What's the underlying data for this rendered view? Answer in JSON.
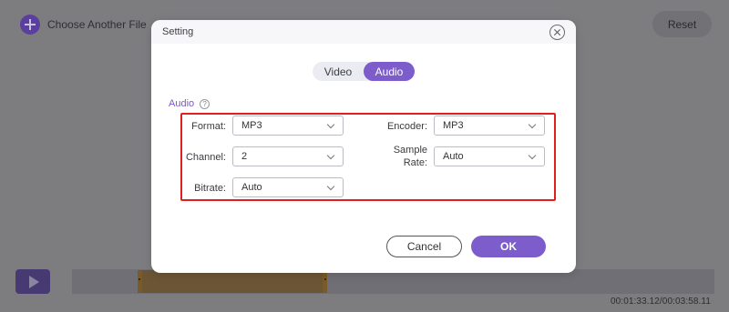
{
  "app": {
    "choose_file_label": "Choose Another File",
    "reset_label": "Reset",
    "time_readout": "00:01:33.12/00:03:58.11"
  },
  "dialog": {
    "title": "Setting",
    "tabs": [
      {
        "label": "Video",
        "selected": false
      },
      {
        "label": "Audio",
        "selected": true
      }
    ],
    "section_label": "Audio",
    "help_icon": "?",
    "fields": {
      "format": {
        "label": "Format:",
        "value": "MP3"
      },
      "channel": {
        "label": "Channel:",
        "value": "2"
      },
      "bitrate": {
        "label": "Bitrate:",
        "value": "Auto"
      },
      "encoder": {
        "label": "Encoder:",
        "value": "MP3"
      },
      "sample_rate": {
        "label_line1": "Sample",
        "label_line2": "Rate:",
        "value": "Auto"
      }
    },
    "cancel_label": "Cancel",
    "ok_label": "OK"
  },
  "colors": {
    "accent": "#7d5ccc",
    "highlight": "#e0201f",
    "overlay": "#7d7d80"
  }
}
